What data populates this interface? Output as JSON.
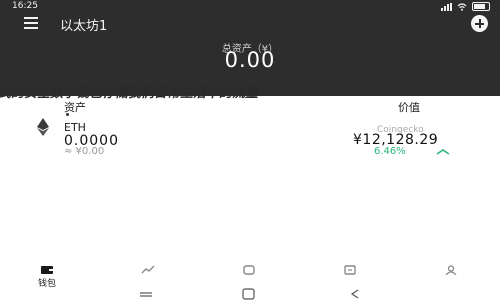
{
  "status": {
    "time": "16:25"
  },
  "header": {
    "wallet_name": "以太坊1",
    "assets_label": "总资产（¥）",
    "balance": "0.00"
  },
  "overlay_text": "式的安全数字钱包存储我们日常生活中的流量",
  "columns": {
    "asset": "资产",
    "value": "价值"
  },
  "token": {
    "name": "ETH",
    "source": "Coingecko",
    "amount": "0.0000",
    "fiat": "≈ ¥0.00",
    "price": "¥12,128.29",
    "change": "6.46%",
    "change_color": "#2cb67d"
  },
  "nav": [
    {
      "label": "钱包",
      "icon": "wallet-icon"
    },
    {
      "label": "",
      "icon": "market-icon"
    },
    {
      "label": "",
      "icon": "discover-icon"
    },
    {
      "label": "",
      "icon": "exchange-icon"
    },
    {
      "label": "",
      "icon": "profile-icon"
    }
  ]
}
